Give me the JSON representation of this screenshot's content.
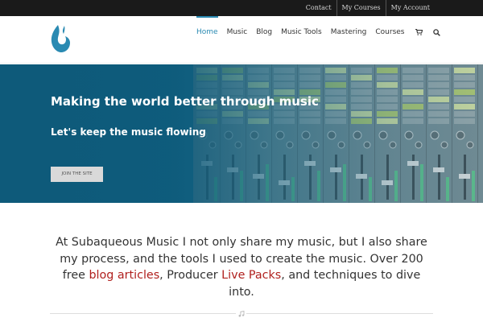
{
  "topbar": {
    "links": [
      "Contact",
      "My Courses",
      "My Account"
    ]
  },
  "header": {
    "logo_icon": "water-drop-logo-icon",
    "nav": [
      "Home",
      "Music",
      "Blog",
      "Music Tools",
      "Mastering",
      "Courses"
    ],
    "active": "Home",
    "cart_icon": "cart-icon",
    "search_icon": "search-icon"
  },
  "hero": {
    "title": "Making the world better through music",
    "subtitle": "Let's keep the music flowing",
    "button_label": "JOIN THE SITE"
  },
  "intro": {
    "text_1": "At Subaqueous Music I not only share my music, but I also share my process, and the tools I used to create the music. Over 200 free ",
    "link_1": "blog articles",
    "text_2": ", Producer ",
    "link_2": "Live Packs",
    "text_3": ", and techniques to dive into."
  },
  "divider_icon": "music-note-icon",
  "colors": {
    "accent": "#2a8ab2",
    "hero_blue": "#13698b",
    "link_red": "#b0201e",
    "topbar": "#1a1a1a"
  }
}
